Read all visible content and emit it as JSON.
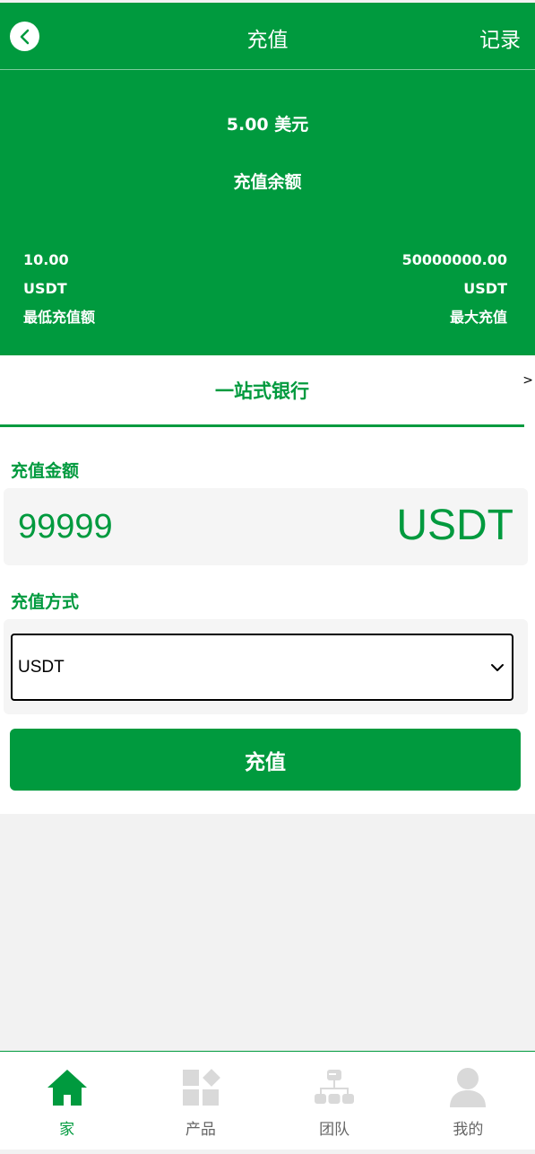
{
  "header": {
    "title": "充值",
    "record_label": "记录"
  },
  "balance": {
    "amount": "5.00 美元",
    "label": "充值余额",
    "min": {
      "value": "10.00",
      "unit": "USDT",
      "label": "最低充值额"
    },
    "max": {
      "value": "50000000.00",
      "unit": "USDT",
      "label": "最大充值"
    }
  },
  "bank": {
    "tab_label": "一站式银行",
    "tab_arrow": ">"
  },
  "form": {
    "amount_label": "充值金额",
    "amount_value": "99999",
    "amount_unit": "USDT",
    "method_label": "充值方式",
    "method_selected": "USDT",
    "submit_label": "充值"
  },
  "nav": {
    "items": [
      {
        "label": "家",
        "icon": "home-icon",
        "active": true
      },
      {
        "label": "产品",
        "icon": "grid-icon",
        "active": false
      },
      {
        "label": "团队",
        "icon": "team-icon",
        "active": false
      },
      {
        "label": "我的",
        "icon": "user-icon",
        "active": false
      }
    ]
  },
  "colors": {
    "primary": "#009a3e",
    "inactive_icon": "#d9d9d9",
    "background": "#f2f2f2"
  }
}
